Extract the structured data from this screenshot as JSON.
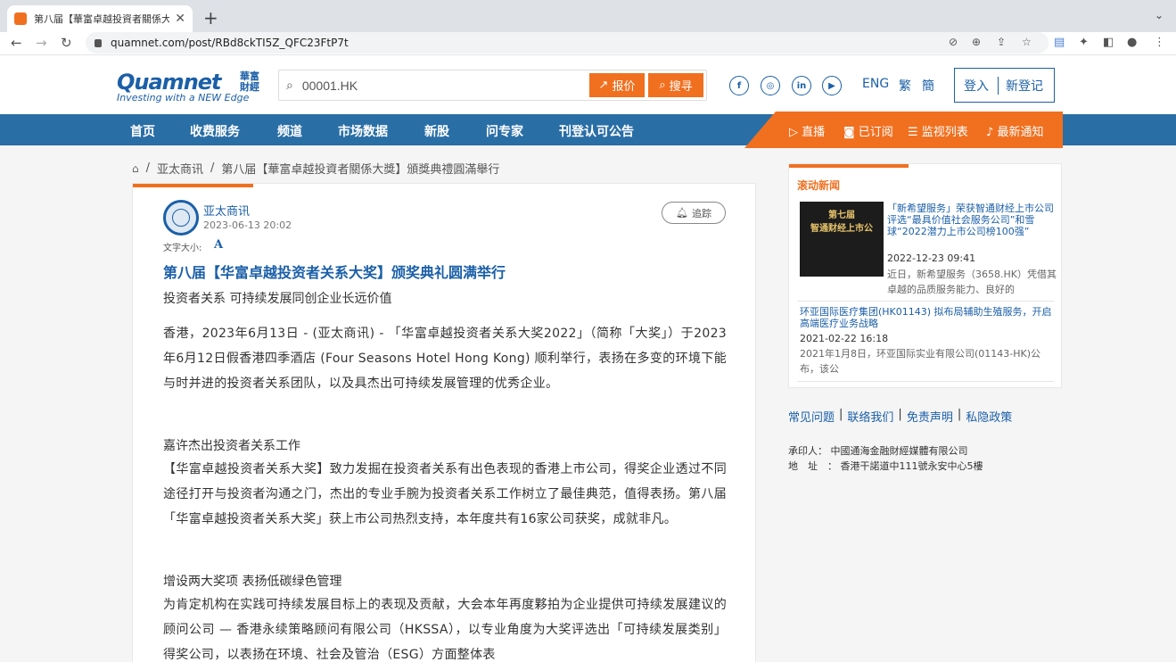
{
  "browser": {
    "tab_title": "第八届【華富卓越投資者關係大獎",
    "url": "quamnet.com/post/RBd8ckTI5Z_QFC23FtP7t"
  },
  "header": {
    "logo_main": "Quamnet",
    "logo_cn": "華富財經",
    "logo_tagline": "Investing with a NEW Edge",
    "search_value": "00001.HK",
    "quote_label": "报价",
    "search_label": "搜寻",
    "lang_eng": "ENG",
    "lang_trad": "繁",
    "lang_simp": "簡",
    "login": "登入",
    "register": "新登记"
  },
  "nav": {
    "items": [
      "首页",
      "收费服务",
      "频道",
      "市场数据",
      "新股",
      "问专家",
      "刊登认可公告"
    ],
    "right_items": [
      "直播",
      "已订阅",
      "监视列表",
      "最新通知"
    ]
  },
  "breadcrumb": {
    "items": [
      "亚太商讯",
      "第八届【華富卓越投資者關係大獎】頒獎典禮圓滿舉行"
    ]
  },
  "article": {
    "author": "亚太商讯",
    "published": "2023-06-13 20:02",
    "follow_label": "追踪",
    "font_size_label": "文字大小:",
    "font_size_icon": "A",
    "title": "第八届【华富卓越投资者关系大奖】颁奖典礼圆满举行",
    "subtitle": "投资者关系 可持续发展同创企业长远价值",
    "para1": "香港，2023年6月13日 - (亚太商讯) - 「华富卓越投资者关系大奖2022」（简称「大奖」）于2023年6月12日假香港四季酒店 (Four Seasons Hotel Hong Kong) 顺利举行，表扬在多变的环境下能与时并进的投资者关系团队，以及具杰出可持续发展管理的优秀企业。",
    "heading2": "嘉许杰出投资者关系工作",
    "para2": "【华富卓越投资者关系大奖】致力发掘在投资者关系有出色表现的香港上市公司，得奖企业透过不同途径打开与投资者沟通之门，杰出的专业手腕为投资者关系工作树立了最佳典范，值得表扬。第八届「华富卓越投资者关系大奖」获上市公司热烈支持，本年度共有16家公司获奖，成就非凡。",
    "heading3": "增设两大奖项 表扬低碳绿色管理",
    "para3": "为肯定机构在实践可持续发展目标上的表现及贡献，大会本年再度夥拍为企业提供可持续发展建议的顾问公司 — 香港永续策略顾问有限公司（HKSSA），以专业角度为大奖评选出「可持续发展类别」得奖公司，以表扬在环境、社会及管治（ESG）方面整体表"
  },
  "sidebar": {
    "title": "滚动新闻",
    "news": [
      {
        "title": "「新希望服务」荣获智通财经上市公司评选“最具价值社会服务公司”和雪球“2022潜力上市公司榜100强”",
        "time": "2022-12-23 09:41",
        "excerpt": "近日，新希望服务（3658.HK）凭借其卓越的品质服务能力、良好的",
        "thumb_line1": "第七届",
        "thumb_line2": "智通财经上市公"
      },
      {
        "title": "环亚国际医疗集团(HK01143) 拟布局辅助生殖服务，开启高端医疗业务战略",
        "time": "2021-02-22 16:18",
        "excerpt": "2021年1月8日，环亚国际实业有限公司(01143-HK)公布，该公"
      }
    ]
  },
  "footer": {
    "links": [
      "常见问题",
      "联络我们",
      "免责声明",
      "私隐政策"
    ],
    "printer_label": "承印人：",
    "printer": "中國通海金融財經媒體有限公司",
    "address_label": "地　址　：",
    "address": "香港干諾道中111號永安中心5樓"
  },
  "colors": {
    "brand_blue": "#1b5fa8",
    "nav_blue": "#2a6ea6",
    "accent_orange": "#f07020"
  }
}
